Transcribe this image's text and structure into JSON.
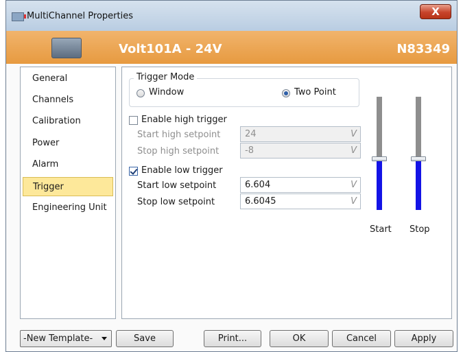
{
  "window": {
    "title": "MultiChannel Properties",
    "close_label": "X"
  },
  "header": {
    "device_name": "Volt101A - 24V",
    "serial": "N83349"
  },
  "sidebar": {
    "items": [
      {
        "label": "General"
      },
      {
        "label": "Channels"
      },
      {
        "label": "Calibration"
      },
      {
        "label": "Power"
      },
      {
        "label": "Alarm"
      },
      {
        "label": "Trigger",
        "selected": true
      },
      {
        "label": "Engineering Unit"
      }
    ]
  },
  "trigger": {
    "mode_group_label": "Trigger Mode",
    "mode_options": [
      {
        "label": "Window",
        "selected": false
      },
      {
        "label": "Two Point",
        "selected": true
      }
    ],
    "high": {
      "enable_label": "Enable high trigger",
      "enabled": false,
      "start_label": "Start high setpoint",
      "start_value": "24",
      "stop_label": "Stop high setpoint",
      "stop_value": "-8",
      "unit": "V"
    },
    "low": {
      "enable_label": "Enable low trigger",
      "enabled": true,
      "start_label": "Start low setpoint",
      "start_value": "6.604",
      "stop_label": "Stop low setpoint",
      "stop_value": "6.6045",
      "unit": "V"
    },
    "sliders": [
      {
        "label": "Start",
        "level": 0.45
      },
      {
        "label": "Stop",
        "level": 0.45
      }
    ]
  },
  "footer": {
    "template_value": "-New Template-",
    "save_label": "Save",
    "print_label": "Print...",
    "ok_label": "OK",
    "cancel_label": "Cancel",
    "apply_label": "Apply"
  },
  "colors": {
    "header_orange": "#e79a40",
    "selected_item": "#fde89a",
    "slider_fill": "#1414e6",
    "close_red": "#c7442b"
  },
  "icons": {
    "window_icon": "multichannel-app-icon",
    "device_icon": "device-icon"
  }
}
